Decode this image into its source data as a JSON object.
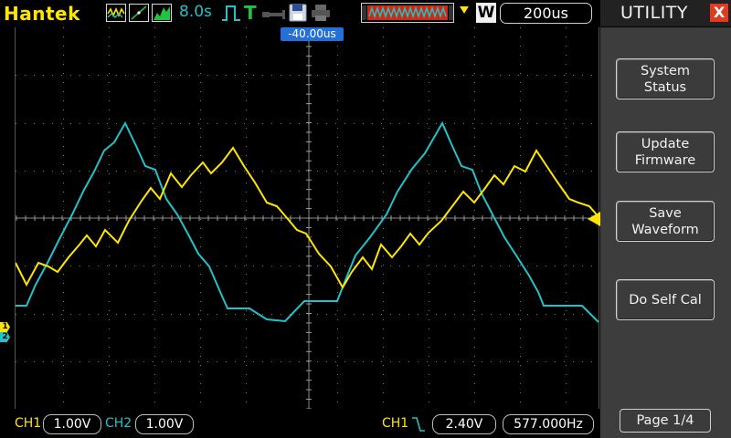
{
  "topbar": {
    "brand": "Hantek",
    "persist_time": "8.0s",
    "trigger_mode": "T",
    "timebase": "200us",
    "window_badge": "W",
    "h_position": "-40.00us",
    "icons": [
      "waveform-icon",
      "xy-mode-icon",
      "spectrum-icon",
      "pulse-trigger-icon",
      "trigger-mode-icon",
      "usb-plug-icon",
      "save-disk-icon",
      "printer-icon"
    ]
  },
  "bottombar": {
    "ch1_label": "CH1",
    "ch1_scale": "1.00V",
    "ch2_label": "CH2",
    "ch2_scale": "1.00V",
    "trigger_source": "CH1",
    "trigger_level": "2.40V",
    "frequency": "577.000Hz"
  },
  "menu": {
    "title": "UTILITY",
    "close": "X",
    "buttons": [
      {
        "line1": "System",
        "line2": "Status"
      },
      {
        "line1": "Update",
        "line2": "Firmware"
      },
      {
        "line1": "Save",
        "line2": "Waveform"
      },
      {
        "line1": "Do Self Cal",
        "line2": ""
      }
    ],
    "page": "Page 1/4"
  },
  "markers": {
    "ch1": "1",
    "ch2": "2"
  },
  "colors": {
    "ch1": "#ffe600",
    "ch2": "#22c3c8",
    "trigger_marker": "#ffe600",
    "h_position_marker": "#2470d8",
    "menu_panel": "#3d3d3d"
  }
}
